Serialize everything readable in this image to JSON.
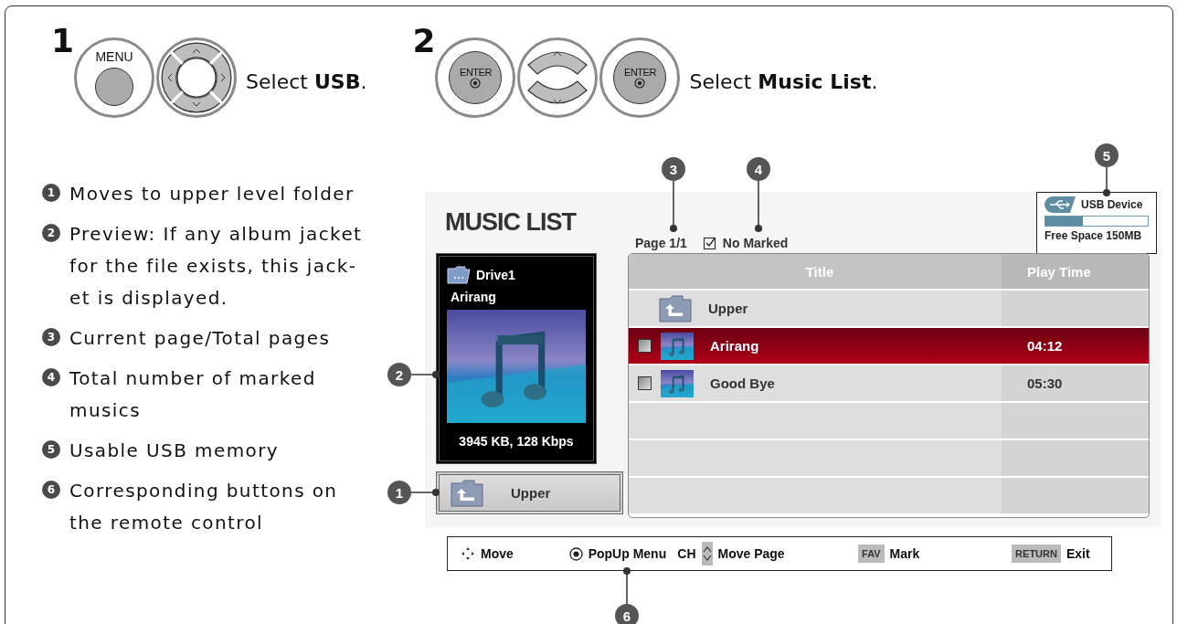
{
  "steps": [
    {
      "number": "1",
      "buttons": [
        {
          "kind": "menu",
          "label": "MENU"
        },
        {
          "kind": "dpad"
        }
      ],
      "text": "Select **USB**."
    },
    {
      "number": "2",
      "buttons": [
        {
          "kind": "enter",
          "label": "ENTER"
        },
        {
          "kind": "updown"
        },
        {
          "kind": "enter",
          "label": "ENTER"
        }
      ],
      "text": "Select **Music List**."
    }
  ],
  "notes": [
    {
      "number": "1",
      "text": "Moves to upper level folder"
    },
    {
      "number": "2",
      "text": "Preview: If any album jacket for the file exists, this jack-et is displayed."
    },
    {
      "number": "3",
      "text": "Current page/Total pages"
    },
    {
      "number": "4",
      "text": "Total number of marked musics"
    },
    {
      "number": "5",
      "text": "Usable USB memory"
    },
    {
      "number": "6",
      "text": "Corresponding buttons on the remote control"
    }
  ],
  "screen": {
    "title": "MUSIC LIST",
    "page": "Page 1/1",
    "marked": "No Marked",
    "usb": {
      "name": "USB Device",
      "level": 0.37,
      "free": "Free Space 150MB"
    },
    "preview": {
      "drive": "Drive1",
      "song": "Arirang",
      "info": "3945 KB, 128 Kbps"
    },
    "upper_button": "Upper",
    "columns": [
      "Title",
      "Play Time"
    ],
    "rows": [
      {
        "kind": "folder",
        "title": "Upper",
        "selected": false
      },
      {
        "kind": "song",
        "title": "Arirang",
        "time": "04:12",
        "selected": true,
        "checked": false
      },
      {
        "kind": "song",
        "title": "Good Bye",
        "time": "05:30",
        "selected": false,
        "checked": false
      }
    ]
  },
  "legend": [
    {
      "kind": "move",
      "label": "Move"
    },
    {
      "kind": "popup",
      "label": "PopUp Menu"
    },
    {
      "kind": "ch",
      "key": "CH",
      "label": "Move Page"
    },
    {
      "kind": "key",
      "key": "FAV",
      "label": "Mark"
    },
    {
      "kind": "key",
      "key": "RETURN",
      "label": "Exit"
    }
  ],
  "callouts": [
    "3",
    "4",
    "5",
    "2",
    "1",
    "6"
  ]
}
